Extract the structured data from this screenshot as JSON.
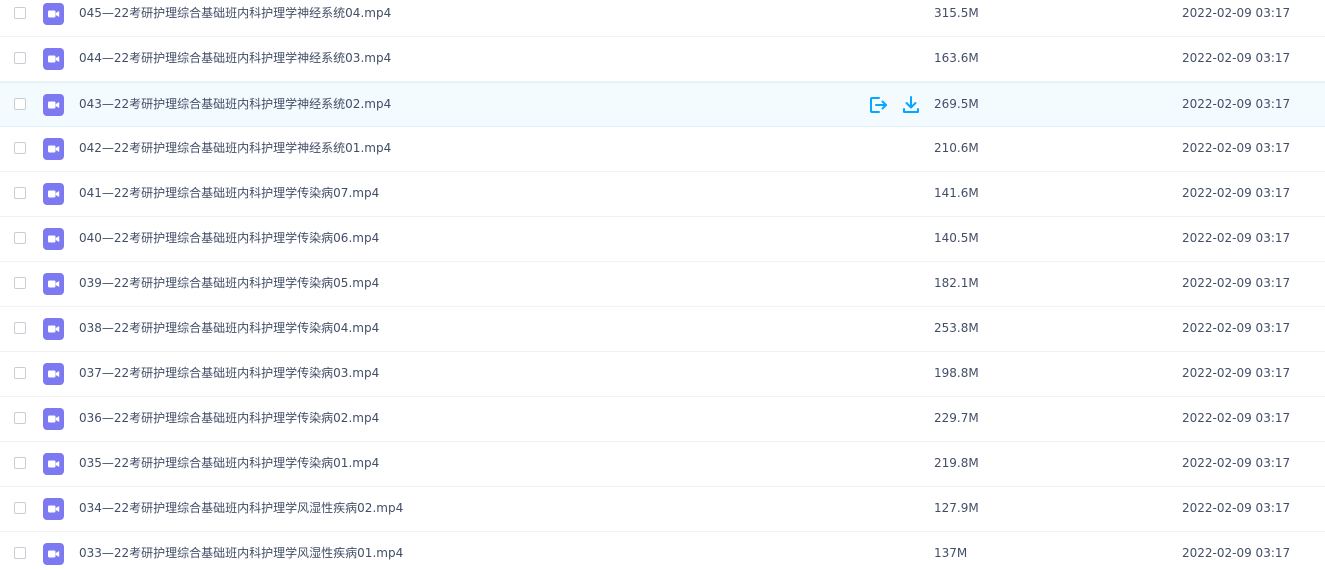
{
  "files": [
    {
      "name": "045—22考研护理综合基础班内科护理学神经系统04.mp4",
      "size": "315.5M",
      "date": "2022-02-09 03:17",
      "icon": "video-file-icon"
    },
    {
      "name": "044—22考研护理综合基础班内科护理学神经系统03.mp4",
      "size": "163.6M",
      "date": "2022-02-09 03:17",
      "icon": "video-file-icon"
    },
    {
      "name": "043—22考研护理综合基础班内科护理学神经系统02.mp4",
      "size": "269.5M",
      "date": "2022-02-09 03:17",
      "icon": "video-file-icon"
    },
    {
      "name": "042—22考研护理综合基础班内科护理学神经系统01.mp4",
      "size": "210.6M",
      "date": "2022-02-09 03:17",
      "icon": "video-file-icon"
    },
    {
      "name": "041—22考研护理综合基础班内科护理学传染病07.mp4",
      "size": "141.6M",
      "date": "2022-02-09 03:17",
      "icon": "video-file-icon"
    },
    {
      "name": "040—22考研护理综合基础班内科护理学传染病06.mp4",
      "size": "140.5M",
      "date": "2022-02-09 03:17",
      "icon": "video-file-icon"
    },
    {
      "name": "039—22考研护理综合基础班内科护理学传染病05.mp4",
      "size": "182.1M",
      "date": "2022-02-09 03:17",
      "icon": "video-file-icon"
    },
    {
      "name": "038—22考研护理综合基础班内科护理学传染病04.mp4",
      "size": "253.8M",
      "date": "2022-02-09 03:17",
      "icon": "video-file-icon"
    },
    {
      "name": "037—22考研护理综合基础班内科护理学传染病03.mp4",
      "size": "198.8M",
      "date": "2022-02-09 03:17",
      "icon": "video-file-icon"
    },
    {
      "name": "036—22考研护理综合基础班内科护理学传染病02.mp4",
      "size": "229.7M",
      "date": "2022-02-09 03:17",
      "icon": "video-file-icon"
    },
    {
      "name": "035—22考研护理综合基础班内科护理学传染病01.mp4",
      "size": "219.8M",
      "date": "2022-02-09 03:17",
      "icon": "video-file-icon"
    },
    {
      "name": "034—22考研护理综合基础班内科护理学风湿性疾病02.mp4",
      "size": "127.9M",
      "date": "2022-02-09 03:17",
      "icon": "video-file-icon"
    },
    {
      "name": "033—22考研护理综合基础班内科护理学风湿性疾病01.mp4",
      "size": "137M",
      "date": "2022-02-09 03:17",
      "icon": "video-file-icon"
    }
  ],
  "hover_row_index": 2,
  "hover_actions": [
    {
      "icon": "share-icon"
    },
    {
      "icon": "download-icon"
    }
  ],
  "colors": {
    "text": "#424e67",
    "video_icon": "#7d79f1",
    "action_icon": "#06a7ff",
    "hover_row": "#f4fbff",
    "row_border": "#f1f2f4"
  }
}
